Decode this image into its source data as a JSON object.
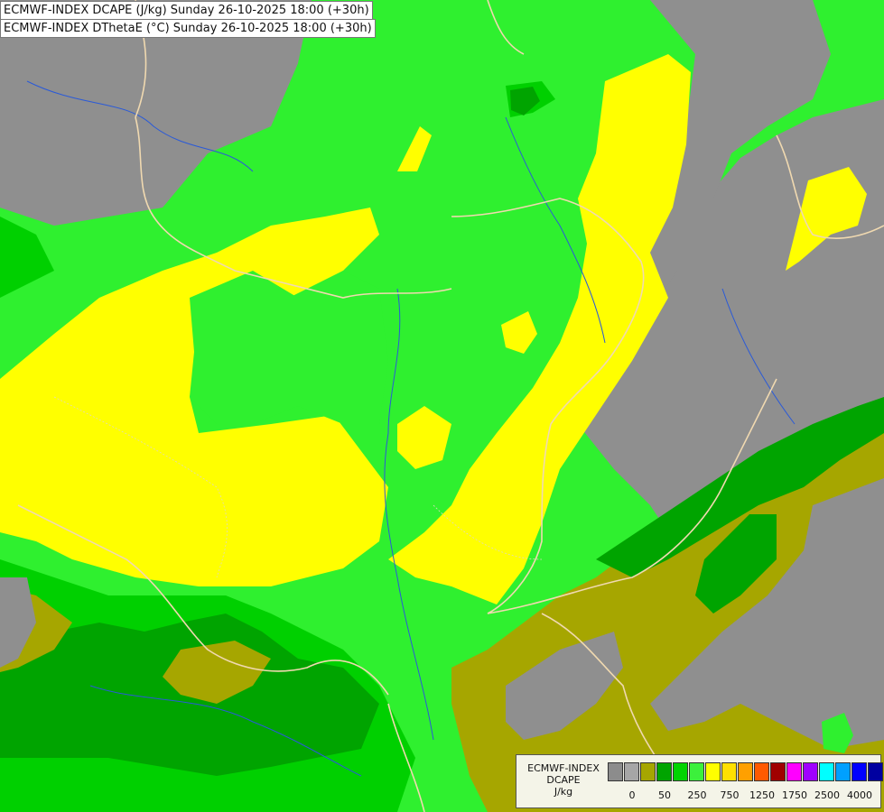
{
  "titles": {
    "line1": "ECMWF-INDEX DCAPE (J/kg) Sunday 26-10-2025 18:00 (+30h)",
    "line2": "ECMWF-INDEX DThetaE (°C) Sunday 26-10-2025 18:00 (+30h)"
  },
  "legend": {
    "title_line1": "ECMWF-INDEX",
    "title_line2": "DCAPE",
    "unit": "J/kg",
    "swatch_colors": [
      "#8c8c8c",
      "#a6a6a6",
      "#a6a600",
      "#00a400",
      "#00d400",
      "#3cf03c",
      "#ffff00",
      "#ffe000",
      "#ffa000",
      "#ff5a00",
      "#a00000",
      "#ff00ff",
      "#a000ff",
      "#00ffff",
      "#00a0ff",
      "#0000ff",
      "#0000a0"
    ],
    "tick_labels": [
      "0",
      "50",
      "250",
      "750",
      "1250",
      "1750",
      "2500",
      "4000"
    ]
  },
  "colors": {
    "sea": "#8f8f8f",
    "class_0": "#a6a600",
    "class_50": "#00a400",
    "class_100": "#00d400",
    "class_250": "#3cf03c",
    "class_500": "#ffff00",
    "border": "#f0d9b0",
    "river": "#2a5ad8"
  }
}
